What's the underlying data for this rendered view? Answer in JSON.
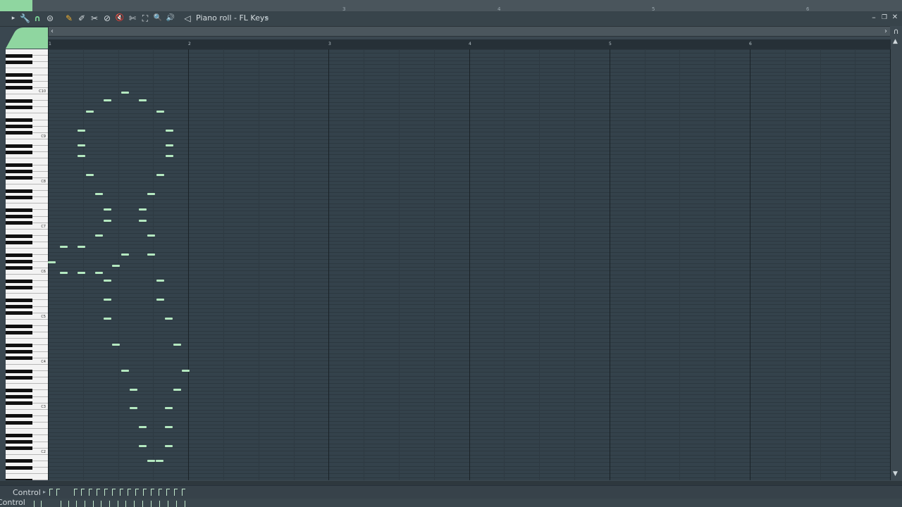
{
  "window": {
    "title": "Piano roll - FL Keys",
    "title_arrow": "▸",
    "minimize": "–",
    "restore": "❐",
    "close": "✕"
  },
  "top_ruler": {
    "ticks": [
      "3",
      "4",
      "5",
      "6"
    ]
  },
  "toolbar": {
    "icons": [
      "menu-arrow-icon",
      "wrench-icon",
      "magnet-icon",
      "snap-circle-icon",
      "pencil-icon",
      "brush-icon",
      "delete-tool-icon",
      "mute-icon",
      "speaker-mute-icon",
      "slice-icon",
      "select-icon",
      "zoom-icon",
      "playback-icon",
      "speaker-icon"
    ],
    "symbols": [
      "▸",
      "🔧",
      "∩",
      "⊜",
      "✎",
      "✐",
      "✂",
      "⊘",
      "🔇",
      "✄",
      "⛶",
      "🔍",
      "🔊",
      "◁"
    ]
  },
  "bar_ruler": {
    "numbers": [
      "1",
      "2",
      "3",
      "4",
      "5",
      "6"
    ]
  },
  "keyboard": {
    "octave_labels": [
      "C10",
      "C9",
      "C8",
      "C7",
      "C6",
      "C5",
      "C4",
      "C3",
      "C2"
    ]
  },
  "control": {
    "label": "Control",
    "arrow": "▸",
    "bottom_label": "Control"
  },
  "colors": {
    "note": "#b4e8c0",
    "grid_bg": "#34424b",
    "accent_green": "#8fd6a0"
  },
  "scroll": {
    "left_arrow": "‹",
    "right_arrow": "›",
    "up_arrow": "▲",
    "down_arrow": "▼",
    "magnet": "∩"
  }
}
